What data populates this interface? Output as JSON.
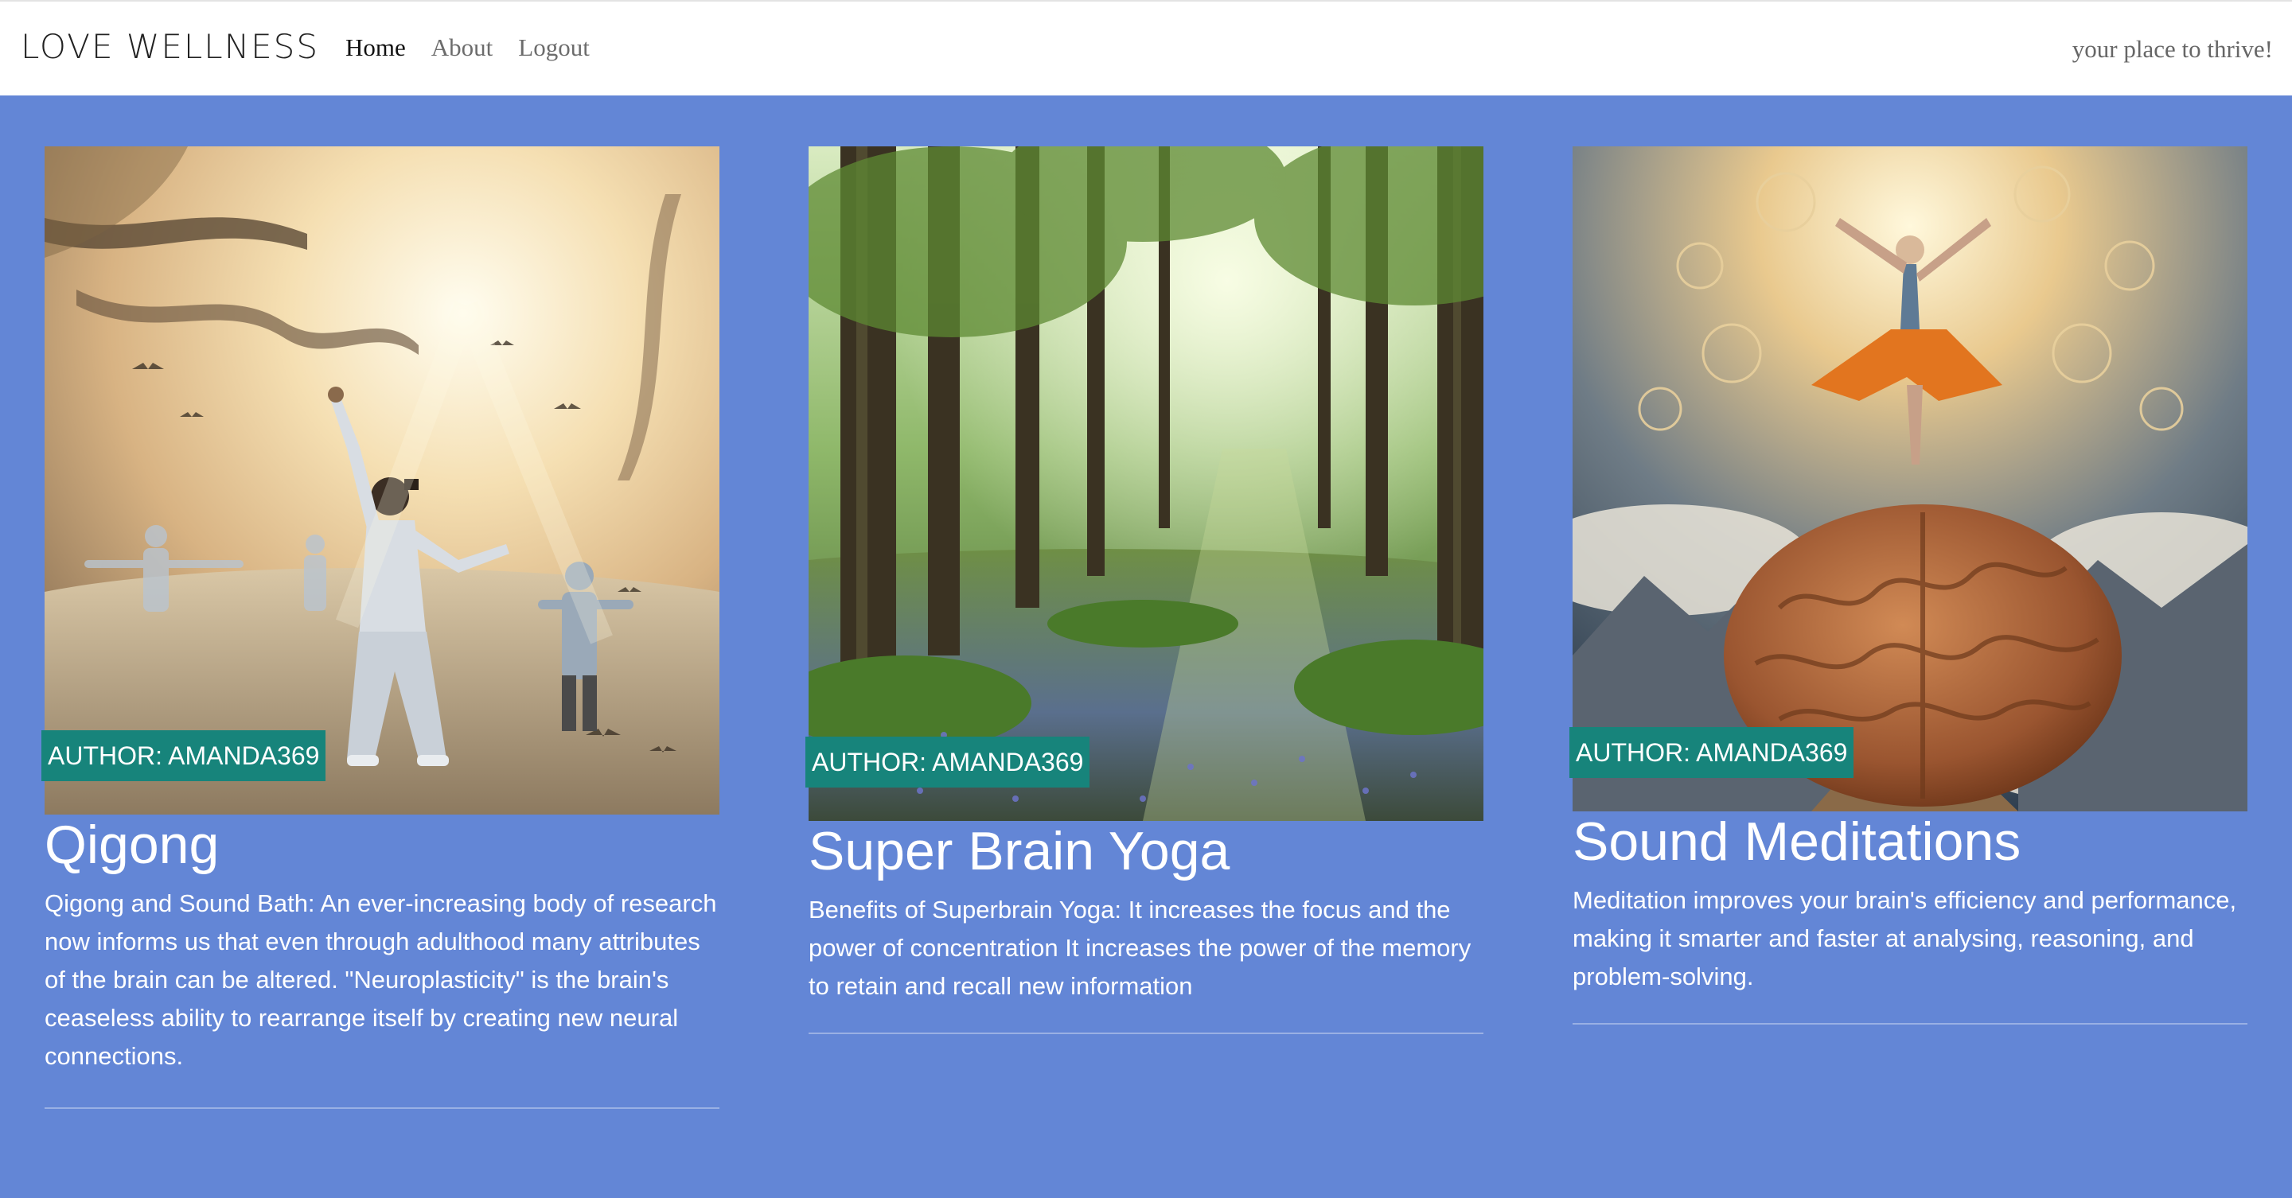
{
  "navbar": {
    "brand": "LOVE WELLNESS",
    "links": [
      {
        "label": "Home",
        "active": true
      },
      {
        "label": "About",
        "active": false
      },
      {
        "label": "Logout",
        "active": false
      }
    ],
    "tagline": "your place to thrive!"
  },
  "colors": {
    "page_background": "#6386d6",
    "navbar_background": "#ffffff",
    "badge_background": "#17847b",
    "text_on_background": "#ffffff"
  },
  "posts": [
    {
      "author_badge": "AUTHOR: AMANDA369",
      "title": "Qigong",
      "description": "Qigong and Sound Bath: An ever-increasing body of research now informs us that even through adulthood many attributes of the brain can be altered. \"Neuroplasticity\" is the brain's ceaseless ability to rearrange itself by creating new neural connections.",
      "image_subject": "people practicing qigong in misty sunlit forest"
    },
    {
      "author_badge": "AUTHOR: AMANDA369",
      "title": "Super Brain Yoga",
      "description": "Benefits of Superbrain Yoga: It increases the focus and the power of concentration It increases the power of the memory to retain and recall new information",
      "image_subject": "sunlit green forest with bluebells"
    },
    {
      "author_badge": "AUTHOR: AMANDA369",
      "title": "Sound Meditations",
      "description": "Meditation improves your brain's efficiency and performance, making it smarter and faster at analysing, reasoning, and problem-solving.",
      "image_subject": "meditating figure standing on a giant brain above mountains"
    }
  ]
}
